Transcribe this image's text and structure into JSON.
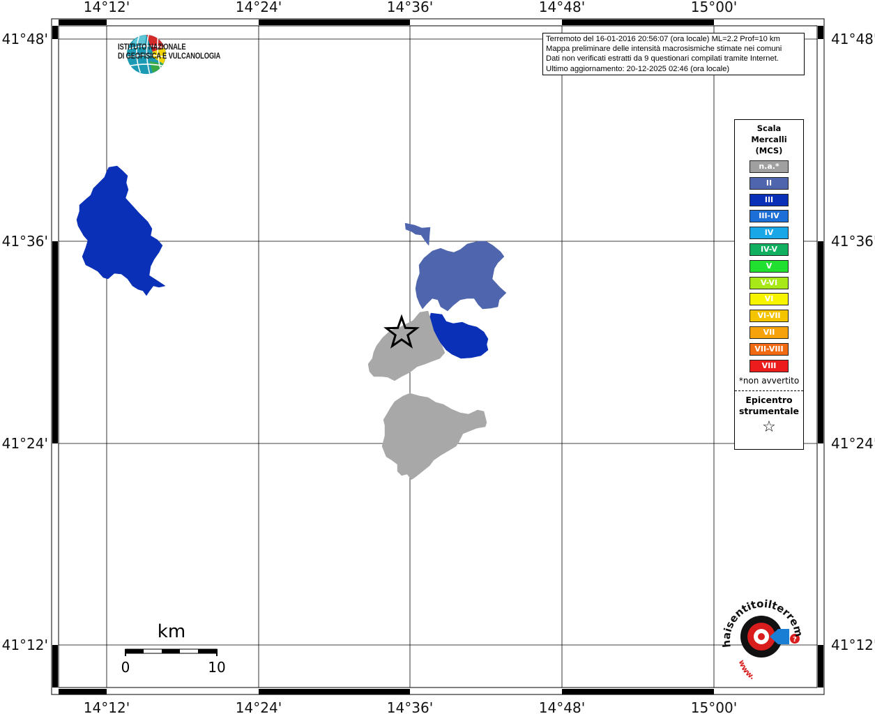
{
  "map": {
    "lon_ticks": [
      "14°12'",
      "14°24'",
      "14°36'",
      "14°48'",
      "15°00'"
    ],
    "lat_ticks": [
      "41°48'",
      "41°36'",
      "41°24'",
      "41°12'"
    ]
  },
  "info": {
    "lines": [
      "Terremoto del 16-01-2016 20:56:07 (ora locale) ML=2.2 Prof=10 km",
      "Mappa preliminare delle intensità macrosismiche stimate nei comuni",
      "Dati non verificati estratti da 9 questionari compilati tramite Internet.",
      "Ultimo aggiornamento: 20-12-2025 02:46 (ora locale)"
    ]
  },
  "institute": {
    "line1": "ISTITUTO NAZIONALE",
    "line2": "DI GEOFISICA E VULCANOLOGIA"
  },
  "legend": {
    "title_lines": [
      "Scala",
      "Mercalli",
      "(MCS)"
    ],
    "items": [
      {
        "label": "n.a.*",
        "color": "#a0a0a0"
      },
      {
        "label": "II",
        "color": "#4f66ae"
      },
      {
        "label": "III",
        "color": "#0a30b8"
      },
      {
        "label": "III-IV",
        "color": "#1b6fd6"
      },
      {
        "label": "IV",
        "color": "#1aa7e8"
      },
      {
        "label": "IV-V",
        "color": "#10b060"
      },
      {
        "label": "V",
        "color": "#22e030"
      },
      {
        "label": "V-VI",
        "color": "#a8e818"
      },
      {
        "label": "VI",
        "color": "#f6f400"
      },
      {
        "label": "VI-VII",
        "color": "#f4c400"
      },
      {
        "label": "VII",
        "color": "#f6a20c"
      },
      {
        "label": "VII-VIII",
        "color": "#f06a12"
      },
      {
        "label": "VIII",
        "color": "#ec1c1c"
      }
    ],
    "note": "*non avvertito",
    "epicenter_line1": "Epicentro",
    "epicenter_line2": "strumentale"
  },
  "scalebar": {
    "unit": "km",
    "start": "0",
    "end": "10"
  },
  "brand": {
    "text": "haisentitoilterremoto.it",
    "sub": "www."
  }
}
